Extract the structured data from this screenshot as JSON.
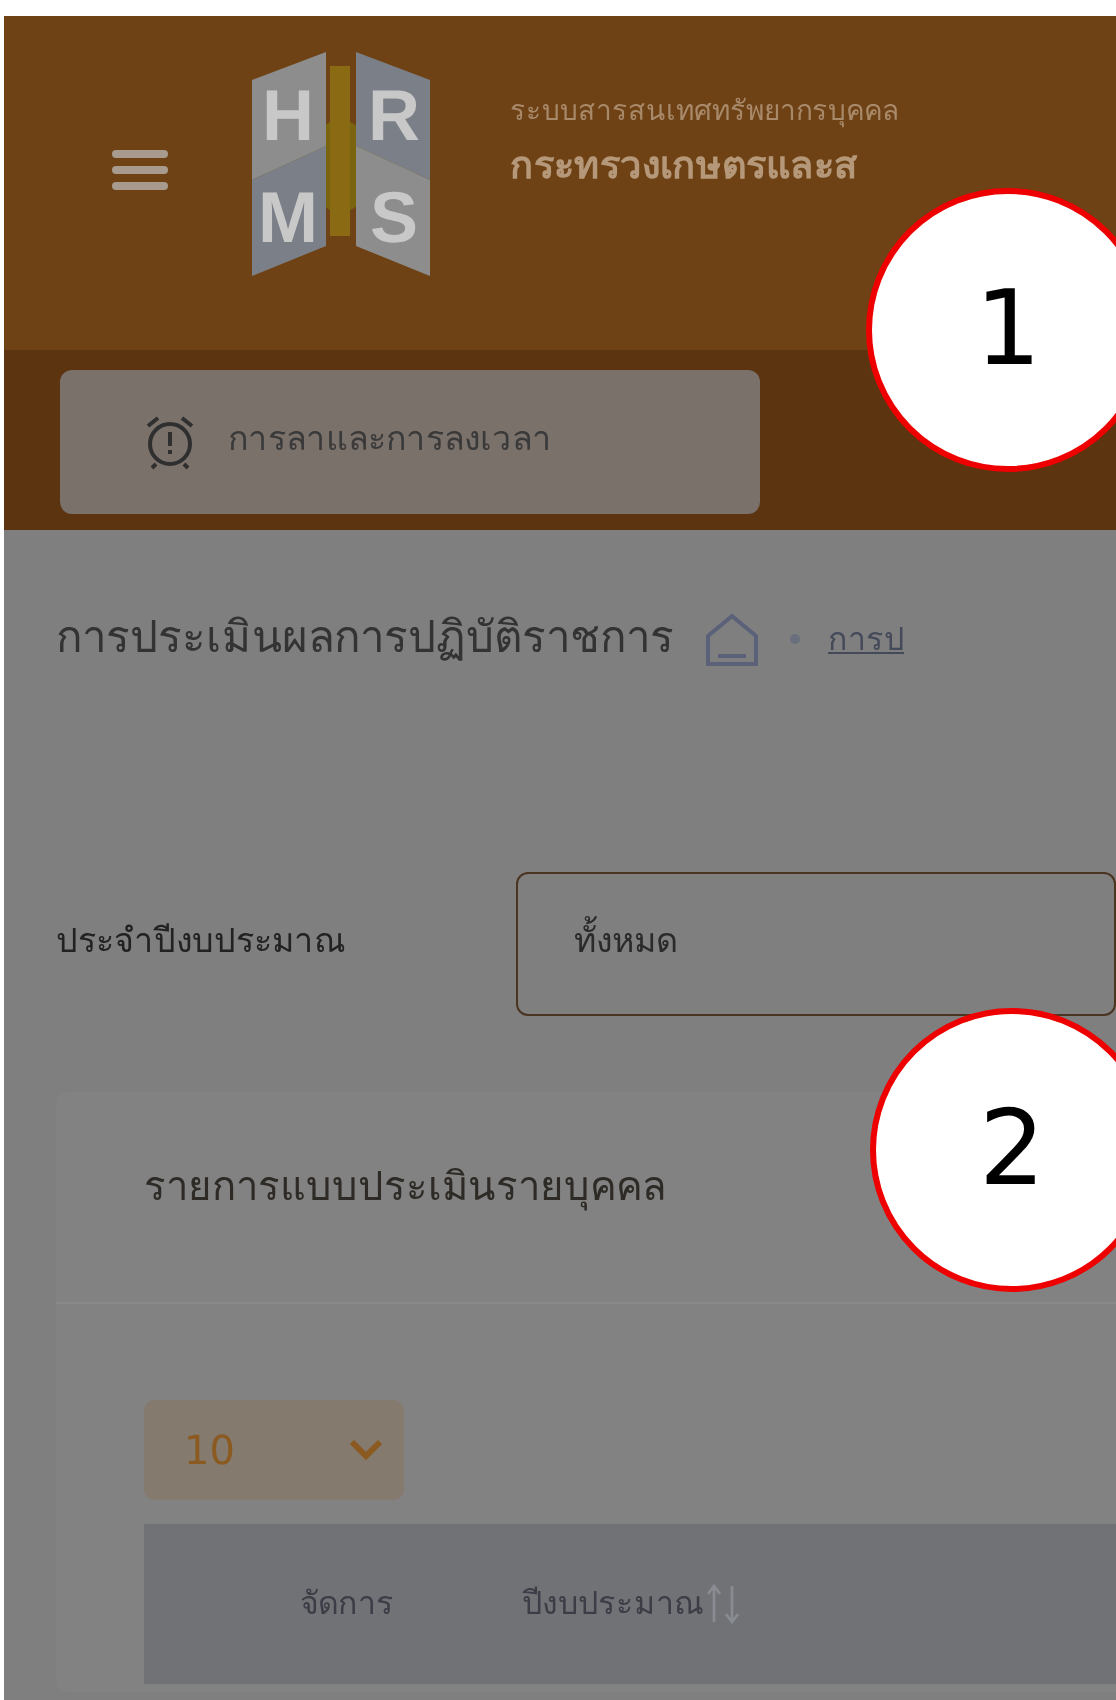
{
  "header": {
    "logo_letters": [
      "H",
      "R",
      "M",
      "S"
    ],
    "system_name": "ระบบสารสนเทศทรัพยากรบุคคล",
    "ministry": "กระทรวงเกษตรและส"
  },
  "quick_menu": [
    {
      "label": "การลาและการลงเวลา"
    }
  ],
  "page": {
    "title": "การประเมินผลการปฏิบัติราชการ",
    "breadcrumb": [
      "การป"
    ]
  },
  "filter": {
    "label": "ประจำปีงบประมาณ",
    "value": "ทั้งหมด"
  },
  "card": {
    "title": "รายการแบบประเมินรายบุคคล",
    "page_size": "10",
    "columns": [
      {
        "label": "จัดการ",
        "sortable": false
      },
      {
        "label": "ปีงบประมาณ",
        "sortable": true
      }
    ]
  },
  "callouts": [
    "1",
    "2"
  ]
}
